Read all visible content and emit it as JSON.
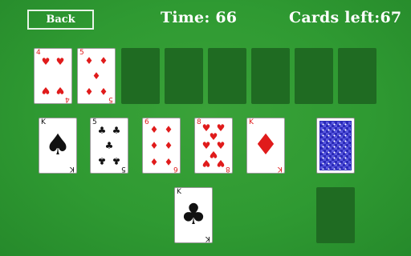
{
  "header": {
    "back_label": "Back",
    "time_text": "Time: 66",
    "cards_left_text": "Cards left:67"
  },
  "foundation": [
    {
      "rank": "4",
      "suit": "♥",
      "color": "red"
    },
    {
      "rank": "5",
      "suit": "♦",
      "color": "red"
    }
  ],
  "tableau": [
    {
      "rank": "K",
      "suit": "♠",
      "color": "black"
    },
    {
      "rank": "5",
      "suit": "♣",
      "color": "black"
    },
    {
      "rank": "6",
      "suit": "♦",
      "color": "red"
    },
    {
      "rank": "8",
      "suit": "♥",
      "color": "red"
    },
    {
      "rank": "K",
      "suit": "♦",
      "color": "red"
    }
  ],
  "reserve": {
    "rank": "K",
    "suit": "♣",
    "color": "black"
  },
  "colors": {
    "felt": "#2f9a32",
    "slot": "#1f6b22",
    "red_suit": "#e01b1b",
    "card_back": "#2a2ab8"
  }
}
